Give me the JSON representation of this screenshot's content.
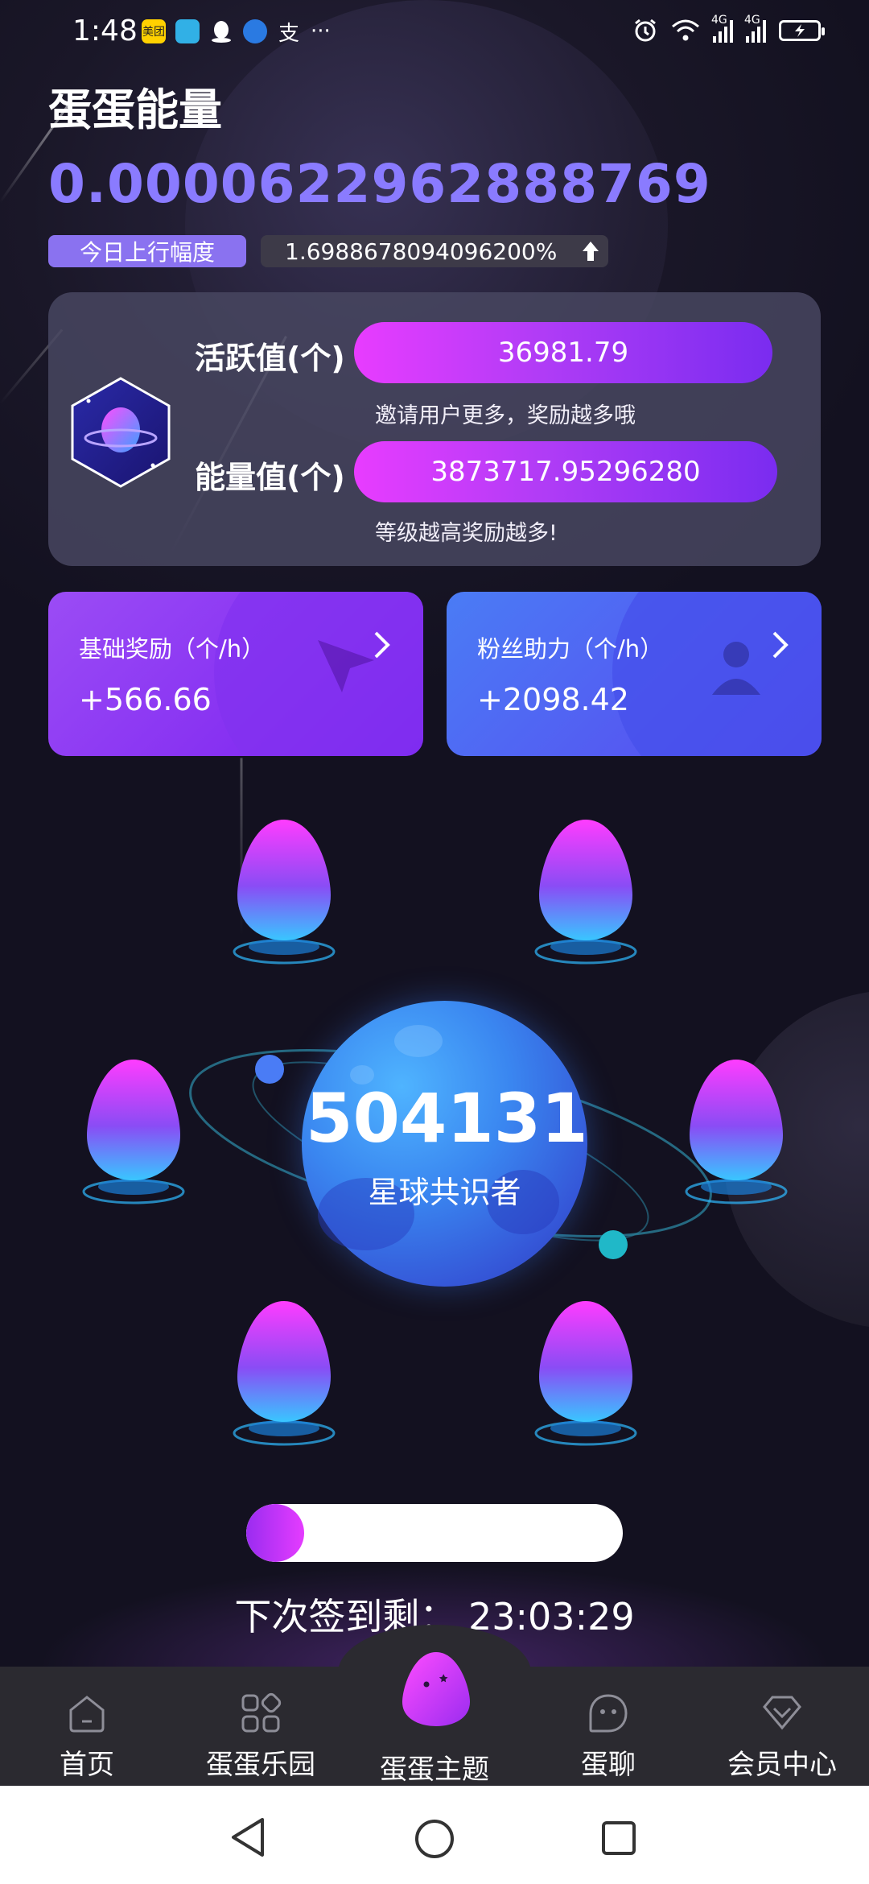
{
  "status_bar": {
    "time": "1:48",
    "app_icons": [
      {
        "name": "meituan-app-icon",
        "text": "美团",
        "color": "#ffd100"
      },
      {
        "name": "app-icon-2",
        "text": "",
        "color": "#31b0e6"
      },
      {
        "name": "qq-icon",
        "text": "",
        "color": "#ffffff"
      },
      {
        "name": "app-icon-4",
        "text": "",
        "color": "#2a7ae2"
      },
      {
        "name": "alipay-icon",
        "text": "支",
        "color": "transparent"
      }
    ],
    "more": "···",
    "network_labels": [
      "4G",
      "4G"
    ]
  },
  "header": {
    "title": "蛋蛋能量",
    "energy_value": "0.0000622962888769",
    "daily_rise_label": "今日上行幅度",
    "daily_rise_value": "1.6988678094096200%"
  },
  "stats_card": {
    "activity_label": "活跃值(个)",
    "activity_value": "36981.79",
    "activity_hint": "邀请用户更多，奖励越多哦",
    "energy_label": "能量值(个)",
    "energy_value": "3873717.95296280",
    "energy_hint": "等级越高奖励越多!"
  },
  "reward_cards": {
    "basic_title": "基础奖励（个/h）",
    "basic_value": "+566.66",
    "fans_title": "粉丝助力（个/h）",
    "fans_value": "+2098.42"
  },
  "planet": {
    "count": "504131",
    "label": "星球共识者"
  },
  "checkin": {
    "progress_fraction": 0.1,
    "text": "下次签到剩：  23:03:29"
  },
  "bottom_nav": {
    "items": [
      {
        "label": "首页",
        "icon": "home-icon"
      },
      {
        "label": "蛋蛋乐园",
        "icon": "grid-apps-icon"
      },
      {
        "label": "蛋蛋主题",
        "icon": "egg-mascot-icon"
      },
      {
        "label": "蛋聊",
        "icon": "chat-face-icon"
      },
      {
        "label": "会员中心",
        "icon": "diamond-icon"
      }
    ]
  },
  "colors": {
    "accent_purple": "#8a7bff",
    "pill_gradient_start": "#e83cff",
    "pill_gradient_end": "#7a2cf0",
    "card_bg": "#484660",
    "planet_blue": "#3a86f0"
  }
}
